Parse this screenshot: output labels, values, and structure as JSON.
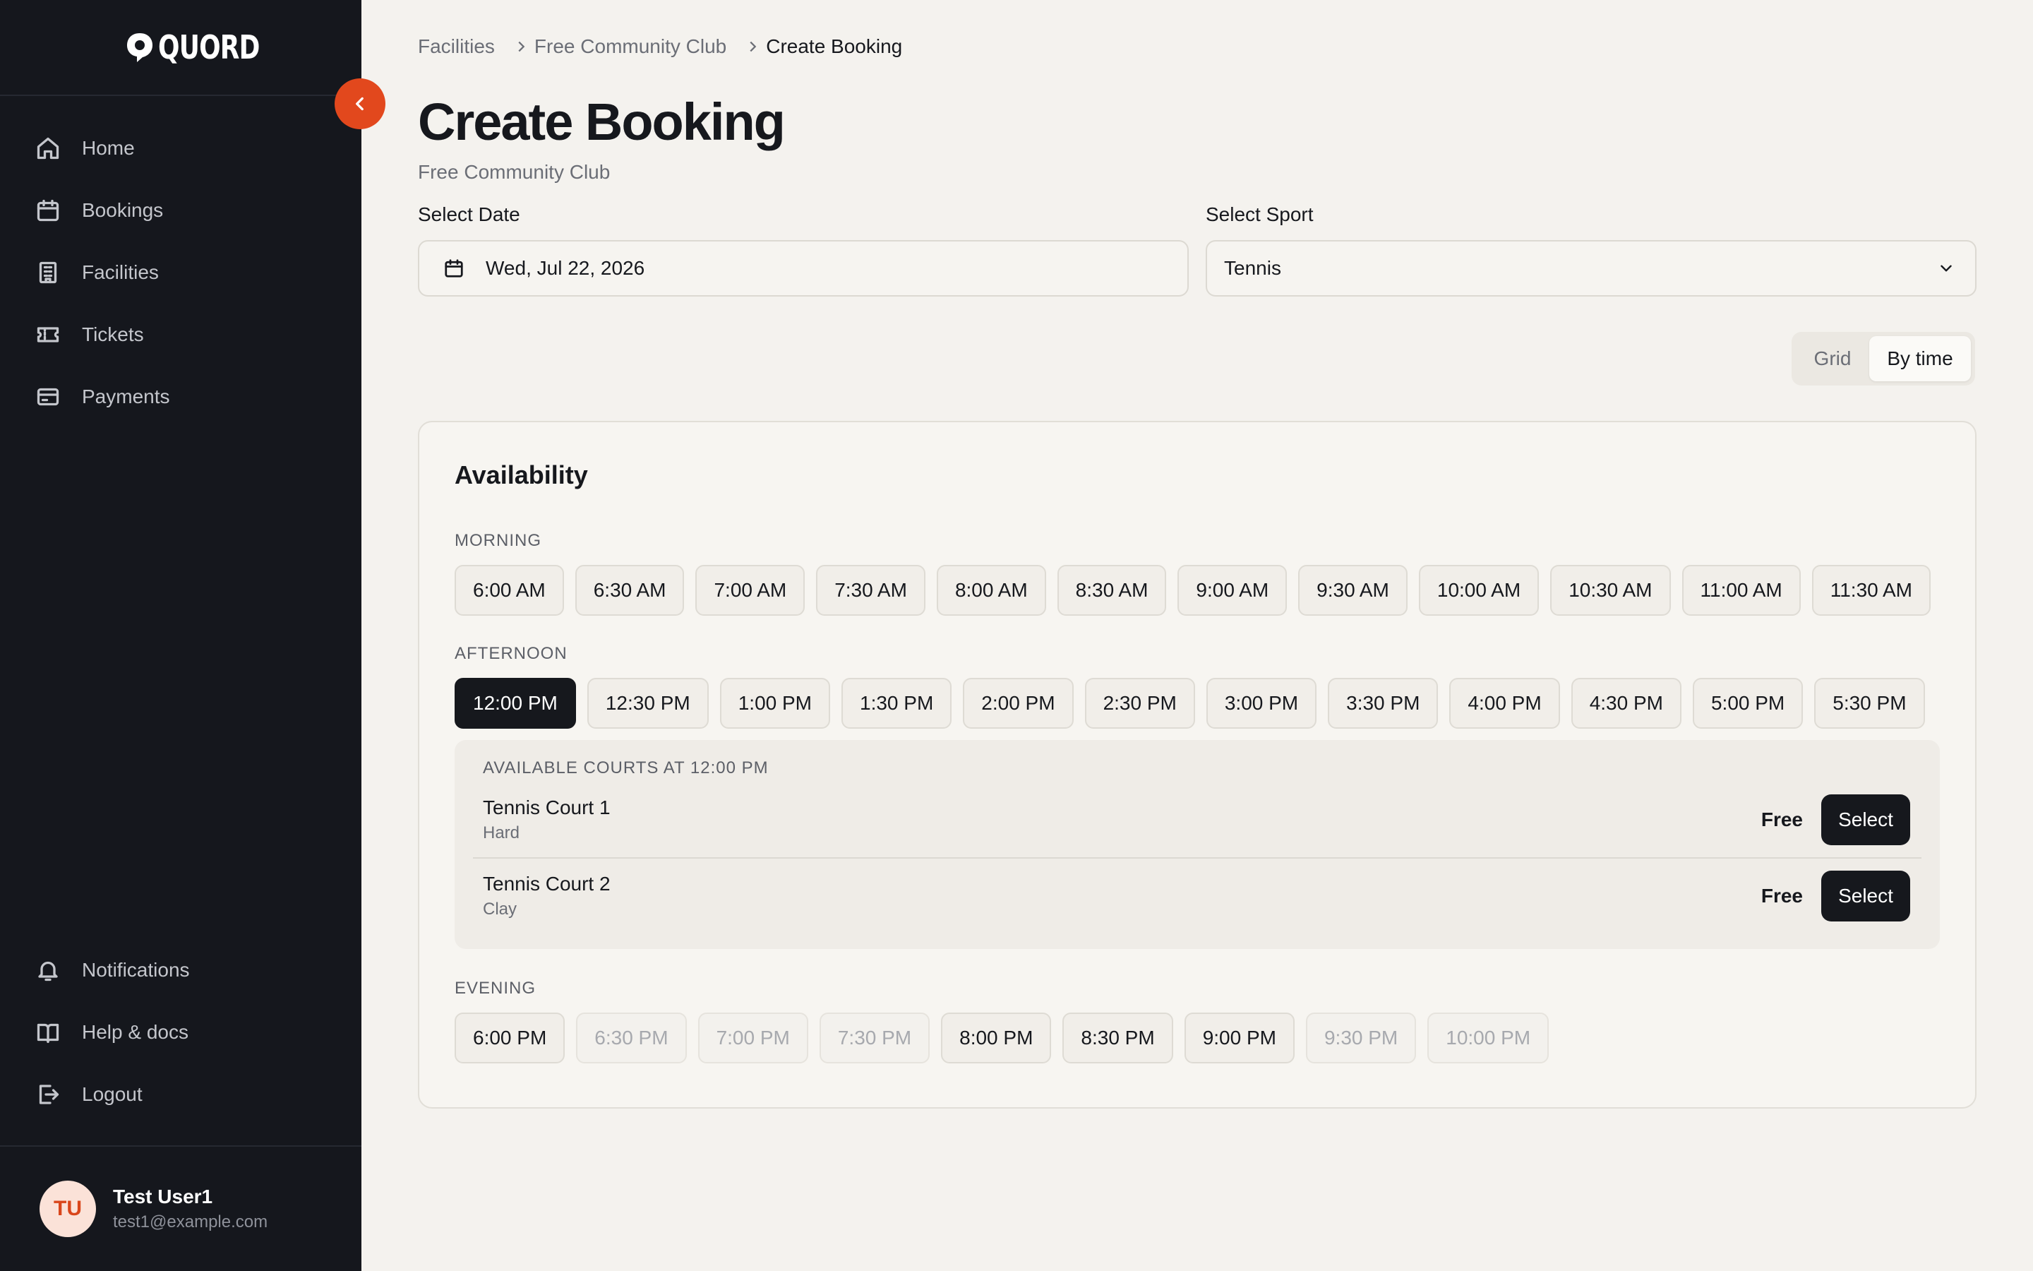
{
  "brand": {
    "name": "QUORD"
  },
  "sidebar": {
    "items": [
      {
        "label": "Home",
        "icon": "home-icon"
      },
      {
        "label": "Bookings",
        "icon": "calendar-icon"
      },
      {
        "label": "Facilities",
        "icon": "building-icon"
      },
      {
        "label": "Tickets",
        "icon": "ticket-icon"
      },
      {
        "label": "Payments",
        "icon": "credit-card-icon"
      }
    ],
    "bottom_items": [
      {
        "label": "Notifications",
        "icon": "bell-icon"
      },
      {
        "label": "Help & docs",
        "icon": "book-icon"
      },
      {
        "label": "Logout",
        "icon": "logout-icon"
      }
    ],
    "user": {
      "initials": "TU",
      "name": "Test User1",
      "email": "test1@example.com"
    }
  },
  "breadcrumb": [
    "Facilities",
    "Free Community Club",
    "Create Booking"
  ],
  "page": {
    "title": "Create Booking",
    "subtitle": "Free Community Club"
  },
  "form": {
    "date_label": "Select Date",
    "date_value": "Wed, Jul 22, 2026",
    "sport_label": "Select Sport",
    "sport_value": "Tennis"
  },
  "view_toggle": {
    "options": [
      "Grid",
      "By time"
    ],
    "active": "By time"
  },
  "availability": {
    "title": "Availability",
    "morning": {
      "label": "MORNING",
      "slots": [
        "6:00 AM",
        "6:30 AM",
        "7:00 AM",
        "7:30 AM",
        "8:00 AM",
        "8:30 AM",
        "9:00 AM",
        "9:30 AM",
        "10:00 AM",
        "10:30 AM",
        "11:00 AM",
        "11:30 AM"
      ]
    },
    "afternoon": {
      "label": "AFTERNOON",
      "slots": [
        "12:00 PM",
        "12:30 PM",
        "1:00 PM",
        "1:30 PM",
        "2:00 PM",
        "2:30 PM",
        "3:00 PM",
        "3:30 PM",
        "4:00 PM",
        "4:30 PM",
        "5:00 PM",
        "5:30 PM"
      ],
      "selected": "12:00 PM"
    },
    "courts": {
      "label": "AVAILABLE COURTS AT 12:00 PM",
      "items": [
        {
          "name": "Tennis Court 1",
          "surface": "Hard",
          "price": "Free",
          "action": "Select"
        },
        {
          "name": "Tennis Court 2",
          "surface": "Clay",
          "price": "Free",
          "action": "Select"
        }
      ]
    },
    "evening": {
      "label": "EVENING",
      "slots": [
        "6:00 PM",
        "6:30 PM",
        "7:00 PM",
        "7:30 PM",
        "8:00 PM",
        "8:30 PM",
        "9:00 PM",
        "9:30 PM",
        "10:00 PM"
      ],
      "disabled": [
        "6:30 PM",
        "7:00 PM",
        "7:30 PM",
        "9:30 PM",
        "10:00 PM"
      ]
    }
  },
  "colors": {
    "sidebar_bg": "#15171d",
    "accent": "#e2481d",
    "page_bg": "#f4f2ee",
    "selected": "#16181d"
  }
}
